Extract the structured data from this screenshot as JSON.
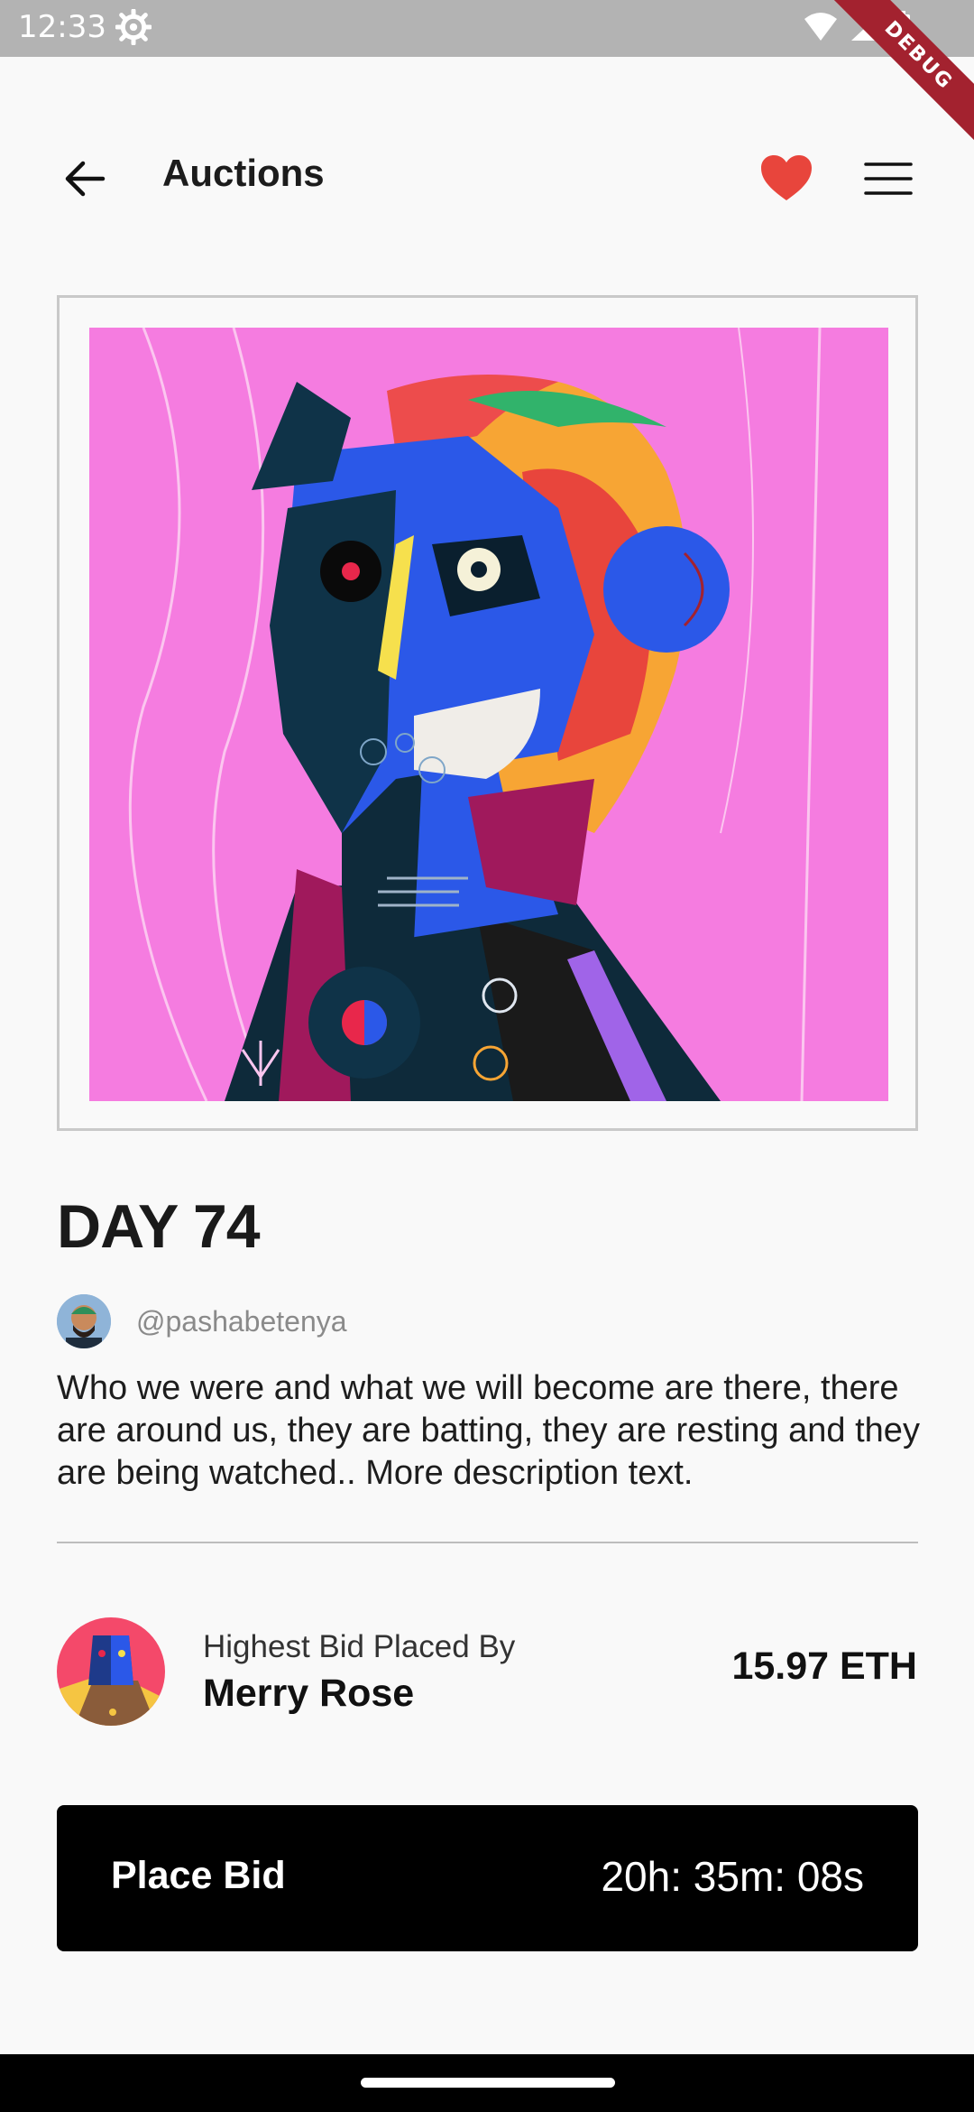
{
  "status_bar": {
    "time": "12:33",
    "debug_label": "DEBUG",
    "icons": [
      "settings-icon",
      "wifi-icon",
      "signal-icon",
      "battery-icon"
    ]
  },
  "app_bar": {
    "title": "Auctions",
    "back_icon": "arrow-left-icon",
    "favorite_icon": "heart-icon",
    "menu_icon": "menu-icon"
  },
  "artwork": {
    "title": "DAY 74",
    "creator_handle": "@pashabetenya",
    "description": "Who we were and what we will become are there, there are around us, they are batting, they are resting and they are being watched..  More description text."
  },
  "bid": {
    "caption": "Highest Bid Placed By",
    "bidder_name": "Merry Rose",
    "amount": "15.97 ETH"
  },
  "action": {
    "place_bid_label": "Place Bid",
    "countdown": "20h: 35m: 08s"
  },
  "colors": {
    "accent_heart": "#e8453c",
    "art_background": "#f57ce0",
    "button_background": "#000000"
  }
}
